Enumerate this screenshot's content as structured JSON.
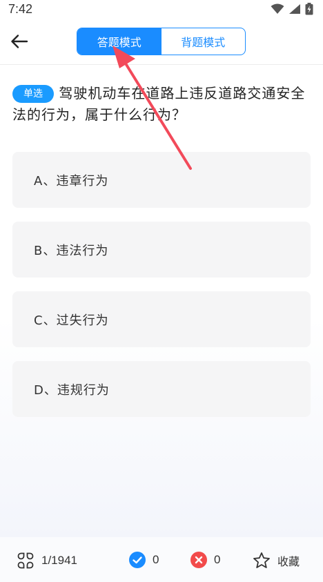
{
  "status_bar": {
    "time": "7:42"
  },
  "header": {
    "modes": [
      {
        "label": "答题模式",
        "active": true
      },
      {
        "label": "背题模式",
        "active": false
      }
    ]
  },
  "question": {
    "type_badge": "单选",
    "text": "驾驶机动车在道路上违反道路交通安全法的行为，属于什么行为？"
  },
  "options": [
    {
      "label": "A、违章行为"
    },
    {
      "label": "B、违法行为"
    },
    {
      "label": "C、过失行为"
    },
    {
      "label": "D、违规行为"
    }
  ],
  "footer": {
    "progress": "1/1941",
    "correct_count": "0",
    "wrong_count": "0",
    "favorite_label": "收藏"
  },
  "colors": {
    "accent": "#1a8cff",
    "correct": "#1a8cff",
    "wrong": "#f24b4b",
    "arrow": "#f24a5a"
  }
}
